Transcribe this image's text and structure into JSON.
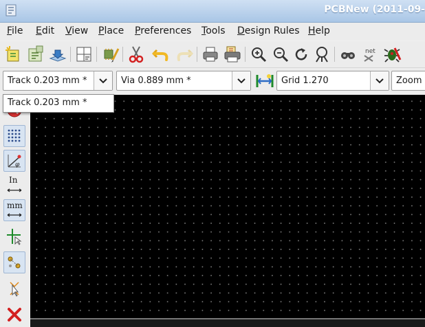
{
  "window": {
    "title": "PCBNew (2011-09-"
  },
  "menu": [
    "File",
    "Edit",
    "View",
    "Place",
    "Preferences",
    "Tools",
    "Design Rules",
    "Help"
  ],
  "menu_mnemonics": [
    "F",
    "E",
    "V",
    "P",
    "P",
    "T",
    "D",
    "H"
  ],
  "toolbar_icons": [
    "new-board-icon",
    "open-board-icon",
    "save-board-icon",
    "page-settings-icon",
    "library-editor-icon",
    "cut-icon",
    "undo-icon",
    "redo-icon",
    "print-icon",
    "plot-icon",
    "zoom-in-icon",
    "zoom-out-icon",
    "redraw-icon",
    "zoom-fit-icon",
    "find-icon",
    "netlist-icon",
    "drc-icon"
  ],
  "options": {
    "track_width": "Track 0.203 mm *",
    "via_size": "Via 0.889 mm *",
    "grid": "Grid 1.270",
    "zoom": "Zoom"
  },
  "track_dropdown": {
    "options": [
      "Track 0.203 mm *"
    ]
  },
  "left_toolbar_icons": [
    "drc-off-icon",
    "grid-toggle-icon",
    "polar-coords-icon",
    "inches-icon",
    "millimeters-icon",
    "cursor-shape-icon",
    "ratsnest-icon",
    "module-ratsnest-icon",
    "delete-icon"
  ],
  "left_toolbar_labels": {
    "inches": "In",
    "millimeters": "mm"
  },
  "colors": {
    "canvas_background": "#000000",
    "grid_dot": "#7a7a7a",
    "title_bar": "#a9c6e6"
  }
}
